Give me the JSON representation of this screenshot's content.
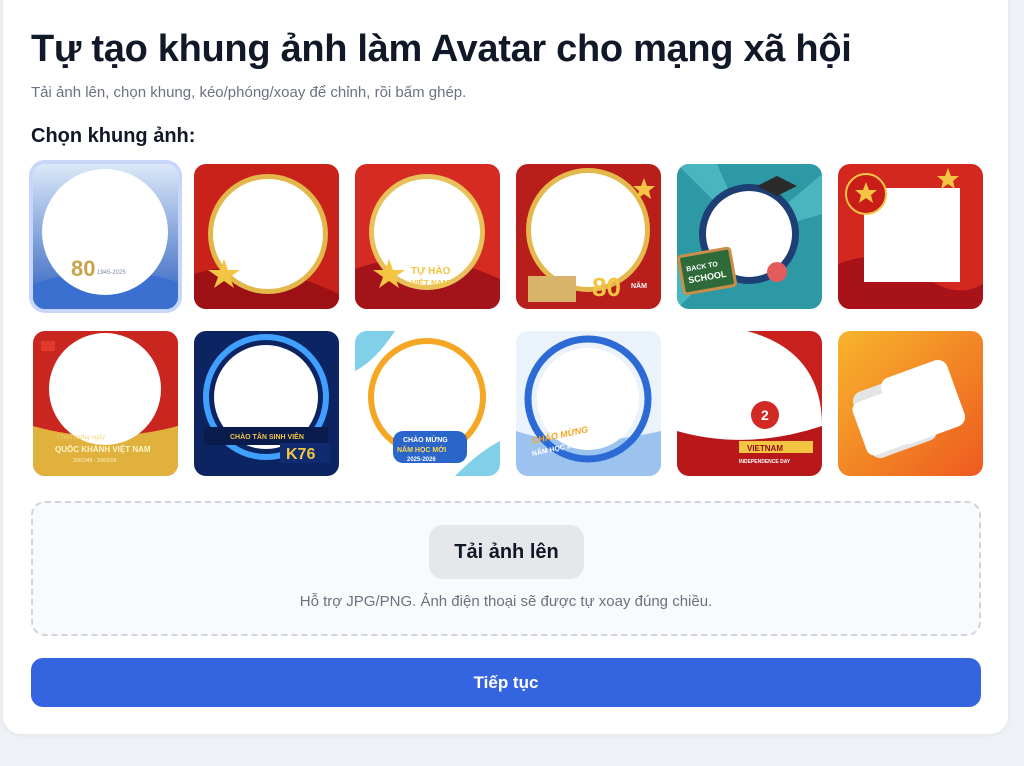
{
  "page": {
    "title": "Tự tạo khung ảnh làm Avatar cho mạng xã hội",
    "subtitle": "Tải ảnh lên, chọn khung, kéo/phóng/xoay để chỉnh, rồi bấm ghép."
  },
  "frame_picker": {
    "label": "Chọn khung ảnh:",
    "selected_index": 0,
    "frames": [
      {
        "theme": "80-nam-blue",
        "colors": [
          "#bcd6f2",
          "#2f5fc0"
        ],
        "hole": "circle",
        "texts": [
          "80",
          "1945-2025"
        ]
      },
      {
        "theme": "red-gold-star",
        "colors": [
          "#d62c22",
          "#b0171a"
        ],
        "hole": "circle",
        "texts": []
      },
      {
        "theme": "tu-hao-viet-nam",
        "colors": [
          "#e03529",
          "#a8141a"
        ],
        "hole": "circle",
        "texts": [
          "TỰ HÀO",
          "VIỆT NAM"
        ]
      },
      {
        "theme": "quoc-khanh-80-nam",
        "colors": [
          "#c7261e",
          "#8f1010"
        ],
        "hole": "circle",
        "texts": [
          "80",
          "NĂM"
        ]
      },
      {
        "theme": "back-to-school",
        "colors": [
          "#3aa7b0",
          "#1e7f89"
        ],
        "hole": "circle",
        "texts": [
          "BACK TO",
          "SCHOOL"
        ]
      },
      {
        "theme": "flag-square",
        "colors": [
          "#e23a2a",
          "#b5161b"
        ],
        "hole": "square",
        "texts": []
      },
      {
        "theme": "quoc-khanh-viet-nam",
        "colors": [
          "#d8352a",
          "#9e1716"
        ],
        "hole": "circle",
        "texts": [
          "Chào mừng ngày",
          "QUỐC KHÁNH VIỆT NAM",
          "2/9/1945 - 2/9/2025"
        ]
      },
      {
        "theme": "k76-tech",
        "colors": [
          "#1b3f8f",
          "#0b1f55"
        ],
        "hole": "circle",
        "texts": [
          "CHÀO TÂN SINH VIÊN",
          "K76"
        ]
      },
      {
        "theme": "nam-hoc-moi-1",
        "colors": [
          "#ffffff",
          "#f5a623"
        ],
        "hole": "circle",
        "texts": [
          "CHÀO MỪNG",
          "NĂM HỌC MỚI",
          "2025-2026"
        ]
      },
      {
        "theme": "nam-hoc-moi-2",
        "colors": [
          "#e9f1fb",
          "#2c6bd6"
        ],
        "hole": "circle",
        "texts": [
          "CHÀO MỪNG",
          "NĂM HỌC 2025-2026"
        ]
      },
      {
        "theme": "vietnam-independence-day",
        "colors": [
          "#ffffff",
          "#c8201c"
        ],
        "hole": "circle",
        "texts": [
          "2",
          "VIETNAM",
          "INDEPENDENCE DAY"
        ]
      },
      {
        "theme": "orange-shapes",
        "colors": [
          "#f5a623",
          "#ef6b1f"
        ],
        "hole": "shape",
        "texts": []
      }
    ]
  },
  "upload": {
    "button_label": "Tải ảnh lên",
    "hint": "Hỗ trợ JPG/PNG. Ảnh điện thoại sẽ được tự xoay đúng chiều."
  },
  "actions": {
    "continue_label": "Tiếp tục"
  }
}
